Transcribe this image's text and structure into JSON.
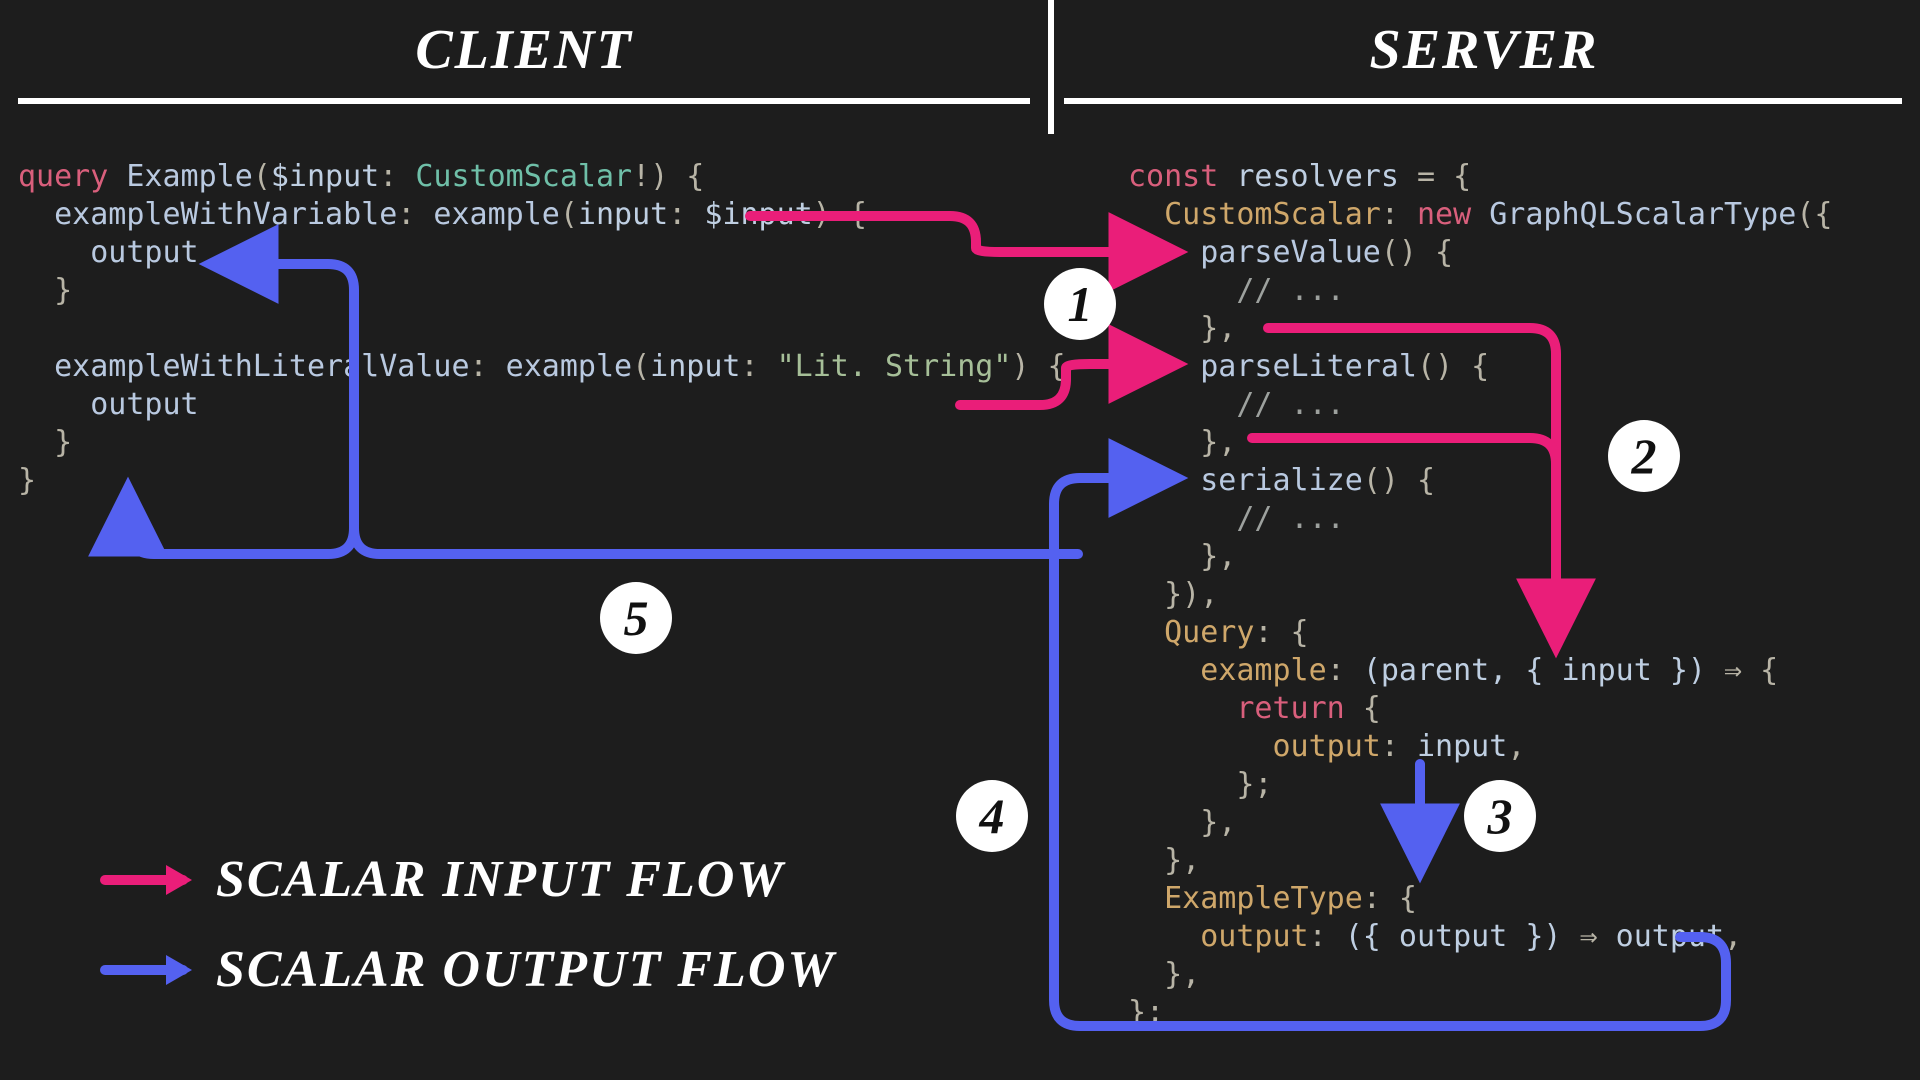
{
  "headers": {
    "client": "CLIENT",
    "server": "SERVER"
  },
  "client_code": {
    "l1": {
      "kw": "query",
      "name": "Example",
      "var": "$input",
      "type": "CustomScalar",
      "bang": "!",
      "open": ") {"
    },
    "l2": {
      "alias": "exampleWithVariable",
      "field": "example",
      "arg": "input",
      "argv": "$input",
      "open": ") {"
    },
    "l3": {
      "field": "output"
    },
    "l4": {
      "close": "}"
    },
    "l5": {
      "blank": ""
    },
    "l6": {
      "alias": "exampleWithLiteralValue",
      "field": "example",
      "arg": "input",
      "str": "\"Lit. String\"",
      "open": ") {"
    },
    "l7": {
      "field": "output"
    },
    "l8": {
      "close": "}"
    },
    "l9": {
      "close": "}"
    }
  },
  "server_code": {
    "l1": {
      "kw": "const",
      "name": "resolvers",
      "eq": "= {"
    },
    "l2": {
      "prop": "CustomScalar",
      "kw": "new",
      "ctor": "GraphQLScalarType",
      "open": "({"
    },
    "l3": {
      "method": "parseValue",
      "open": "() {"
    },
    "l4": {
      "comment": "// ..."
    },
    "l5": {
      "close": "},"
    },
    "l6": {
      "method": "parseLiteral",
      "open": "() {"
    },
    "l7": {
      "comment": "// ..."
    },
    "l8": {
      "close": "},"
    },
    "l9": {
      "method": "serialize",
      "open": "() {"
    },
    "l10": {
      "comment": "// ..."
    },
    "l11": {
      "close": "},"
    },
    "l12": {
      "close": "}),"
    },
    "l13": {
      "prop": "Query",
      "open": ": {"
    },
    "l14": {
      "prop": "example",
      "params": "(parent, { input })",
      "arrow": "⇒",
      "open": " {"
    },
    "l15": {
      "kw": "return",
      "open": " {"
    },
    "l16": {
      "prop": "output",
      "val": "input",
      "comma": ","
    },
    "l17": {
      "close": "};"
    },
    "l18": {
      "close": "},"
    },
    "l19": {
      "close": "},"
    },
    "l20": {
      "prop": "ExampleType",
      "open": ": {"
    },
    "l21": {
      "prop": "output",
      "params": "({ output })",
      "arrow": "⇒",
      "val": " output",
      "comma": ","
    },
    "l22": {
      "close": "},"
    },
    "l23": {
      "close": "};"
    }
  },
  "badges": {
    "b1": "1",
    "b2": "2",
    "b3": "3",
    "b4": "4",
    "b5": "5"
  },
  "legend": {
    "input": "SCALAR INPUT FLOW",
    "output": "SCALAR OUTPUT FLOW"
  },
  "colors": {
    "pink": "#ea1e79",
    "blue": "#5461f0"
  }
}
